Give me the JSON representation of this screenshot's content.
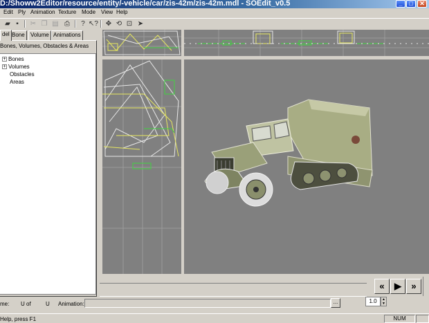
{
  "window": {
    "title": "D:/Showw2Editor/resource/entity/-vehicle/car/zis-42m/zis-42m.mdl - SOEdit_v0.5",
    "buttons": {
      "minimize": "_",
      "maximize": "□",
      "close": "✕"
    }
  },
  "menu": {
    "items": [
      "Edit",
      "Ply",
      "Animation",
      "Texture",
      "Mode",
      "View",
      "Help"
    ]
  },
  "toolbar": {
    "icons": [
      "open-icon",
      "save-icon",
      "cut-icon",
      "copy-icon",
      "paste-icon",
      "print-icon",
      "help-icon",
      "context-help-icon",
      "move-icon",
      "rotate-icon",
      "scale-icon",
      "select-arrow-icon"
    ]
  },
  "left_panel": {
    "tabs": [
      "del",
      "Bone",
      "Volume",
      "Animations"
    ],
    "group_label": "Bones, Volumes, Obstacles & Areas",
    "tree": [
      {
        "label": "Bones",
        "expander": "+"
      },
      {
        "label": "Volumes",
        "expander": "+"
      },
      {
        "label": "Obstacles",
        "expander": ""
      },
      {
        "label": "Areas",
        "expander": ""
      }
    ]
  },
  "playback": {
    "rewind": "«",
    "play": "▶",
    "fast_forward": "»"
  },
  "info": {
    "frame_label": "me:",
    "u_label": "U",
    "of_label": "of",
    "u2_label": "U",
    "animation_label": "Animation:",
    "browse_button": "...",
    "speed_value": "1.0"
  },
  "status": {
    "text": "Help, press F1",
    "num": "NUM"
  },
  "colors": {
    "title_start": "#0a246a",
    "viewport_bg": "#808080",
    "wireframe": "#e8e8e8",
    "wire_yellow": "#e7e760",
    "wire_green": "#3fd33f"
  }
}
